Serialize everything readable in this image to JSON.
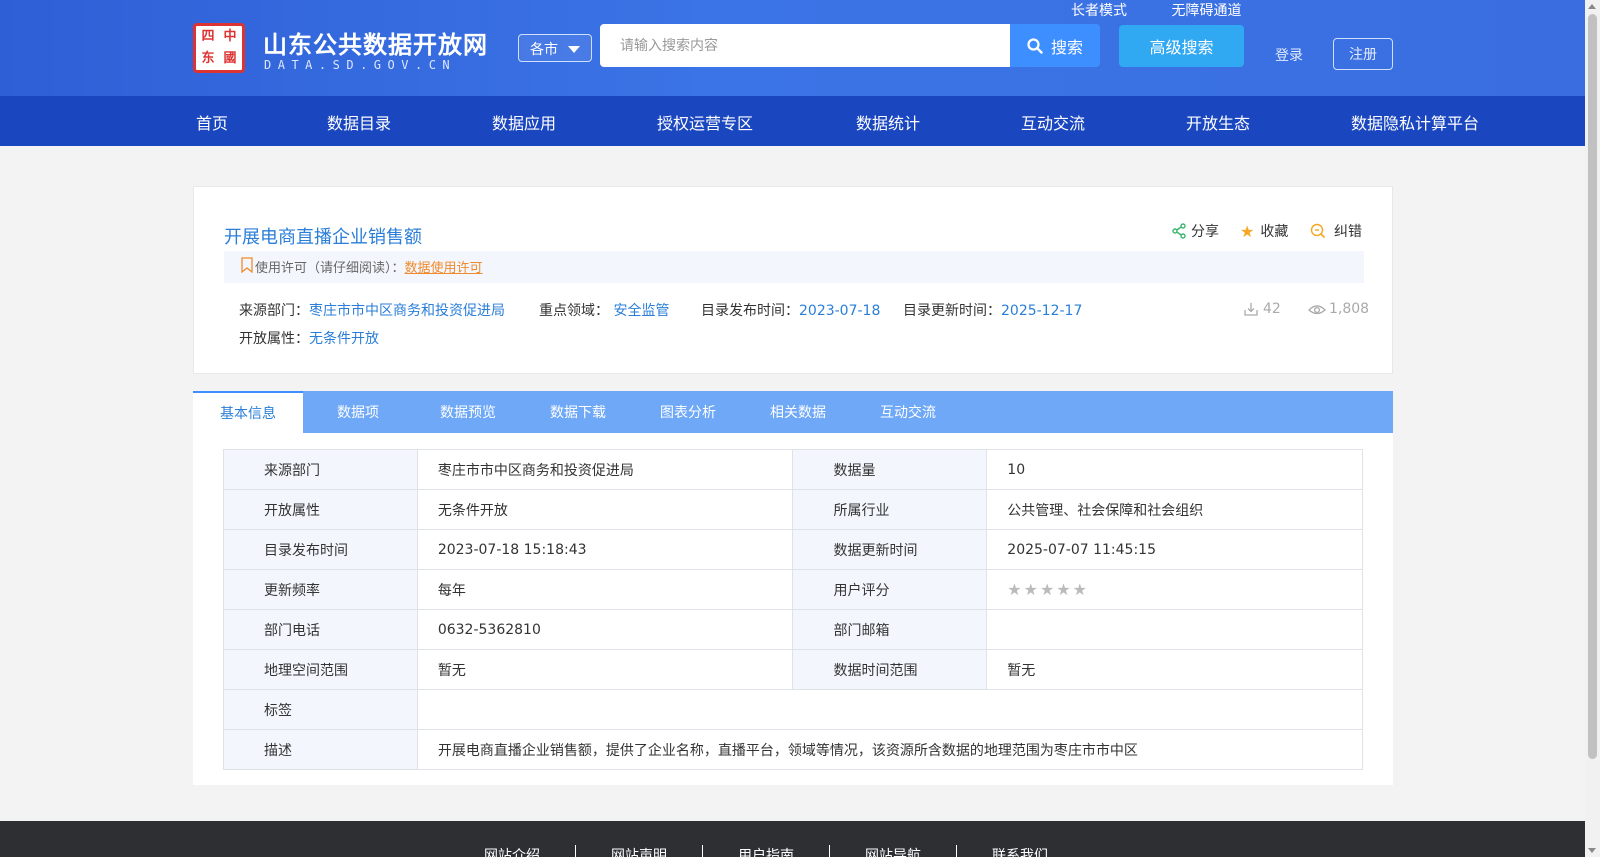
{
  "header": {
    "logo_title": "山东公共数据开放网",
    "logo_sub": "DATA.SD.GOV.CN",
    "top_links": [
      "长者模式",
      "无障碍通道"
    ],
    "city_select": "各市",
    "search_placeholder": "请输入搜索内容",
    "search_button": "搜索",
    "advanced_search": "高级搜索",
    "login": "登录",
    "register": "注册"
  },
  "nav": [
    "首页",
    "数据目录",
    "数据应用",
    "授权运营专区",
    "数据统计",
    "互动交流",
    "开放生态",
    "数据隐私计算平台"
  ],
  "dataset": {
    "title": "开展电商直播企业销售额",
    "actions": {
      "share": "分享",
      "favorite": "收藏",
      "report": "纠错"
    },
    "license_label": "使用许可（请仔细阅读）：",
    "license_link": "数据使用许可",
    "meta": {
      "source_label": "来源部门：",
      "source": "枣庄市市中区商务和投资促进局",
      "field_label": "重点领域：",
      "field": "安全监管",
      "publish_label": "目录发布时间：",
      "publish": "2023-07-18",
      "update_label": "目录更新时间：",
      "update": "2025-12-17",
      "open_label": "开放属性：",
      "open": "无条件开放"
    },
    "downloads": "42",
    "views": "1,808"
  },
  "tabs": [
    "基本信息",
    "数据项",
    "数据预览",
    "数据下载",
    "图表分析",
    "相关数据",
    "互动交流"
  ],
  "info_table": {
    "r1": {
      "k1": "来源部门",
      "v1": "枣庄市市中区商务和投资促进局",
      "k2": "数据量",
      "v2": "10"
    },
    "r2": {
      "k1": "开放属性",
      "v1": "无条件开放",
      "k2": "所属行业",
      "v2": "公共管理、社会保障和社会组织"
    },
    "r3": {
      "k1": "目录发布时间",
      "v1": "2023-07-18 15:18:43",
      "k2": "数据更新时间",
      "v2": "2025-07-07 11:45:15"
    },
    "r4": {
      "k1": "更新频率",
      "v1": "每年",
      "k2": "用户评分",
      "rating": 0,
      "rating_max": 5
    },
    "r5": {
      "k1": "部门电话",
      "v1": "0632-5362810",
      "k2": "部门邮箱",
      "v2": ""
    },
    "r6": {
      "k1": "地理空间范围",
      "v1": "暂无",
      "k2": "数据时间范围",
      "v2": "暂无"
    },
    "r7": {
      "k1": "标签",
      "v1": ""
    },
    "r8": {
      "k1": "描述",
      "v1": "开展电商直播企业销售额，提供了企业名称，直播平台，领域等情况，该资源所含数据的地理范围为枣庄市市中区"
    }
  },
  "footer": [
    "网站介绍",
    "网站声明",
    "用户指南",
    "网站导航",
    "联系我们"
  ],
  "colors": {
    "nav": "#1a46c0",
    "header": "#3b74e6",
    "accent": "#2a7ed8",
    "tab_bar": "#6ea8f7",
    "license_link": "#f08a2c"
  }
}
